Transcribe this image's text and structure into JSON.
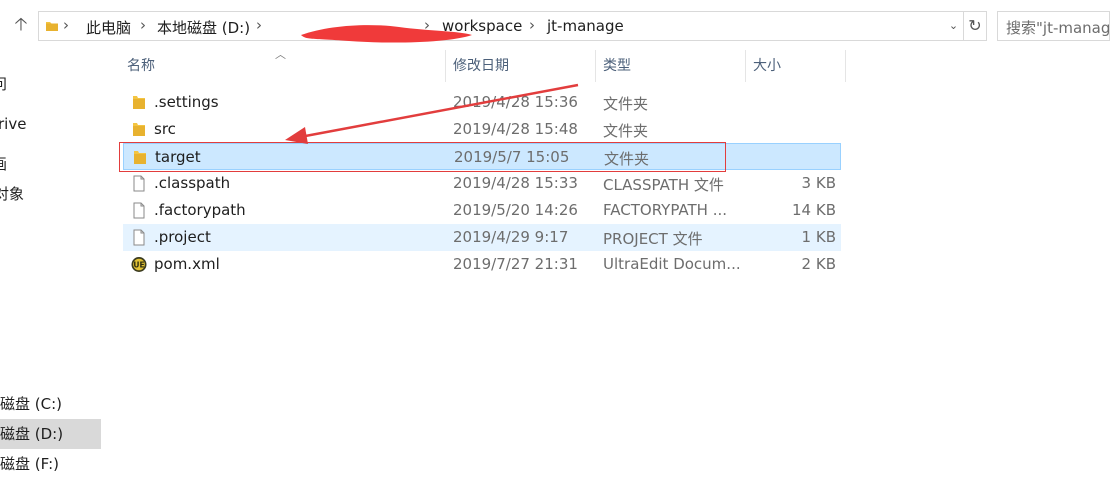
{
  "address": {
    "crumbs": [
      "此电脑",
      "本地磁盘 (D:)",
      "workspace",
      "jt-manage"
    ]
  },
  "search": {
    "placeholder": "搜索\"jt-manage\""
  },
  "nav": {
    "items": [
      {
        "label": "问",
        "partial": true
      },
      {
        "label": "rive",
        "partial": true
      },
      {
        "label": "画",
        "partial": true
      },
      {
        "label": "对象",
        "partial": true
      },
      {
        "label": "磁盘 (C:)"
      },
      {
        "label": "磁盘 (D:)",
        "selected": true
      },
      {
        "label": "磁盘 (F:)"
      }
    ]
  },
  "columns": {
    "name": "名称",
    "date": "修改日期",
    "type": "类型",
    "size": "大小"
  },
  "files": [
    {
      "name": ".settings",
      "date": "2019/4/28 15:36",
      "type": "文件夹",
      "size": "",
      "icon": "folder-icon"
    },
    {
      "name": "src",
      "date": "2019/4/28 15:48",
      "type": "文件夹",
      "size": "",
      "icon": "folder-icon"
    },
    {
      "name": "target",
      "date": "2019/5/7 15:05",
      "type": "文件夹",
      "size": "",
      "icon": "folder-icon",
      "state": "selected"
    },
    {
      "name": ".classpath",
      "date": "2019/4/28 15:33",
      "type": "CLASSPATH 文件",
      "size": "3 KB",
      "icon": "file-icon"
    },
    {
      "name": ".factorypath",
      "date": "2019/5/20 14:26",
      "type": "FACTORYPATH ...",
      "size": "14 KB",
      "icon": "file-icon"
    },
    {
      "name": ".project",
      "date": "2019/4/29 9:17",
      "type": "PROJECT 文件",
      "size": "1 KB",
      "icon": "file-icon",
      "state": "hover"
    },
    {
      "name": "pom.xml",
      "date": "2019/7/27 21:31",
      "type": "UltraEdit Docum...",
      "size": "2 KB",
      "icon": "ultraedit-icon"
    }
  ],
  "colors": {
    "selection": "#cce8ff",
    "hover": "#e5f3ff",
    "annotation": "#e23d3d",
    "folder": "#f4c542"
  }
}
